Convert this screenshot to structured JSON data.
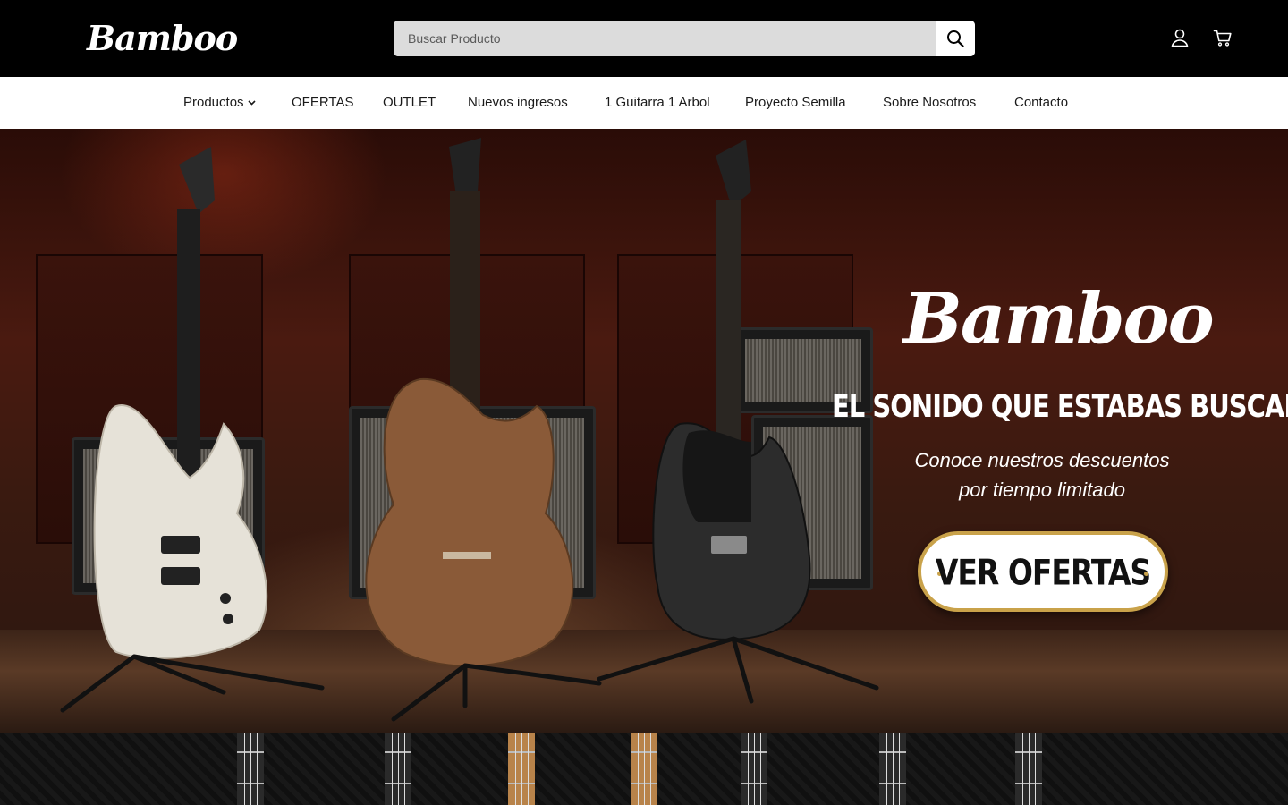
{
  "header": {
    "logo_text": "Bamboo",
    "search_placeholder": "Buscar Producto",
    "icons": {
      "search": "search-icon",
      "account": "user-icon",
      "cart": "cart-icon"
    },
    "background": "#000000"
  },
  "nav": {
    "items": [
      {
        "label": "Productos",
        "has_dropdown": true
      },
      {
        "label": "OFERTAS"
      },
      {
        "label": "OUTLET"
      },
      {
        "label": "Nuevos ingresos"
      },
      {
        "label": "1 Guitarra 1 Arbol"
      },
      {
        "label": "Proyecto Semilla"
      },
      {
        "label": "Sobre Nosotros"
      },
      {
        "label": "Contacto"
      }
    ]
  },
  "hero": {
    "brand": "Bamboo",
    "headline": "EL SONIDO QUE ESTABAS BUSCANDO",
    "subtitle_line1": "Conoce nuestros descuentos",
    "subtitle_line2": "por tiempo limitado",
    "cta_label": "VER OFERTAS",
    "cta_border_color": "#c9a24a"
  }
}
